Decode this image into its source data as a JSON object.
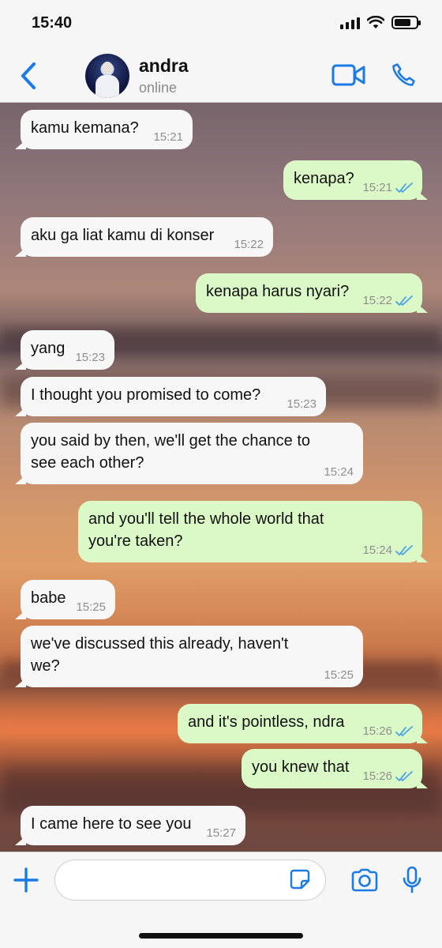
{
  "status_bar": {
    "time": "15:40"
  },
  "header": {
    "name": "andra",
    "status": "online"
  },
  "messages": [
    {
      "dir": "in",
      "text": "kamu kemana?",
      "time": "15:21"
    },
    {
      "dir": "out",
      "text": "kenapa?",
      "time": "15:21",
      "ticks": "double-check"
    },
    {
      "dir": "in",
      "text": "aku ga liat kamu di konser",
      "time": "15:22"
    },
    {
      "dir": "out",
      "text": "kenapa harus nyari?",
      "time": "15:22",
      "ticks": "double-check"
    },
    {
      "dir": "in",
      "text": "yang",
      "time": "15:23"
    },
    {
      "dir": "in",
      "text": "I thought you promised to come?",
      "time": "15:23"
    },
    {
      "dir": "in",
      "text": "you said by then, we'll get the chance to see each other?",
      "time": "15:24"
    },
    {
      "dir": "out",
      "text": "and you'll tell the whole world that you're taken?",
      "time": "15:24",
      "ticks": "double-check"
    },
    {
      "dir": "in",
      "text": "babe",
      "time": "15:25"
    },
    {
      "dir": "in",
      "text": "we've discussed this already, haven't we?",
      "time": "15:25"
    },
    {
      "dir": "out",
      "text": "and it's pointless, ndra",
      "time": "15:26",
      "ticks": "double-check"
    },
    {
      "dir": "out",
      "text": "you knew that",
      "time": "15:26",
      "ticks": "double-check"
    },
    {
      "dir": "in",
      "text": "I came here to see you",
      "time": "15:27"
    }
  ],
  "colors": {
    "accent": "#1a7ae6",
    "outgoing_bubble": "#dbf9c6",
    "incoming_bubble": "#f7f7f7",
    "read_ticks": "#4aa3e8"
  },
  "icons": [
    "back-chevron-icon",
    "video-call-icon",
    "phone-icon",
    "plus-icon",
    "sticker-icon",
    "camera-icon",
    "microphone-icon"
  ],
  "composer": {
    "placeholder": ""
  }
}
